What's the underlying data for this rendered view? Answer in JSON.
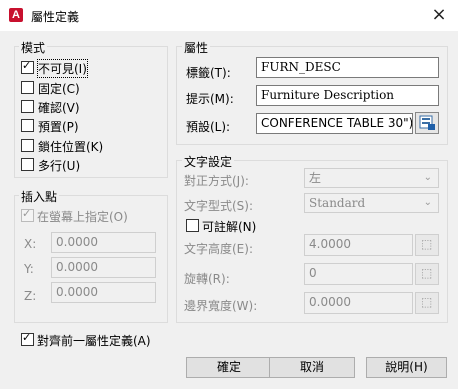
{
  "window": {
    "title": "屬性定義",
    "close_icon": "×"
  },
  "mode": {
    "legend": "模式",
    "items": [
      {
        "label": "不可見(I)",
        "checked": true
      },
      {
        "label": "固定(C)",
        "checked": false
      },
      {
        "label": "確認(V)",
        "checked": false
      },
      {
        "label": "預置(P)",
        "checked": false
      },
      {
        "label": "鎖住位置(K)",
        "checked": false
      },
      {
        "label": "多行(U)",
        "checked": false
      }
    ]
  },
  "insert_point": {
    "legend": "插入點",
    "specify_on_screen": "在螢幕上指定(O)",
    "x_label": "X:",
    "x_value": "0.0000",
    "y_label": "Y:",
    "y_value": "0.0000",
    "z_label": "Z:",
    "z_value": "0.0000"
  },
  "attribute": {
    "legend": "屬性",
    "tag_label": "標籤(T):",
    "tag_value": "FURN_DESC",
    "prompt_label": "提示(M):",
    "prompt_value": "Furniture Description",
    "default_label": "預設(L):",
    "default_value": "CONFERENCE TABLE 30\")"
  },
  "text_settings": {
    "legend": "文字設定",
    "justification_label": "對正方式(J):",
    "justification_value": "左",
    "style_label": "文字型式(S):",
    "style_value": "Standard",
    "annotative_label": "可註解(N)",
    "height_label": "文字高度(E):",
    "height_value": "4.0000",
    "rotation_label": "旋轉(R):",
    "rotation_value": "0",
    "boundary_label": "邊界寬度(W):",
    "boundary_value": "0.0000"
  },
  "align_below": {
    "label": "對齊前一屬性定義(A)",
    "checked": true
  },
  "buttons": {
    "ok": "確定",
    "cancel": "取消",
    "help": "說明(H)"
  }
}
